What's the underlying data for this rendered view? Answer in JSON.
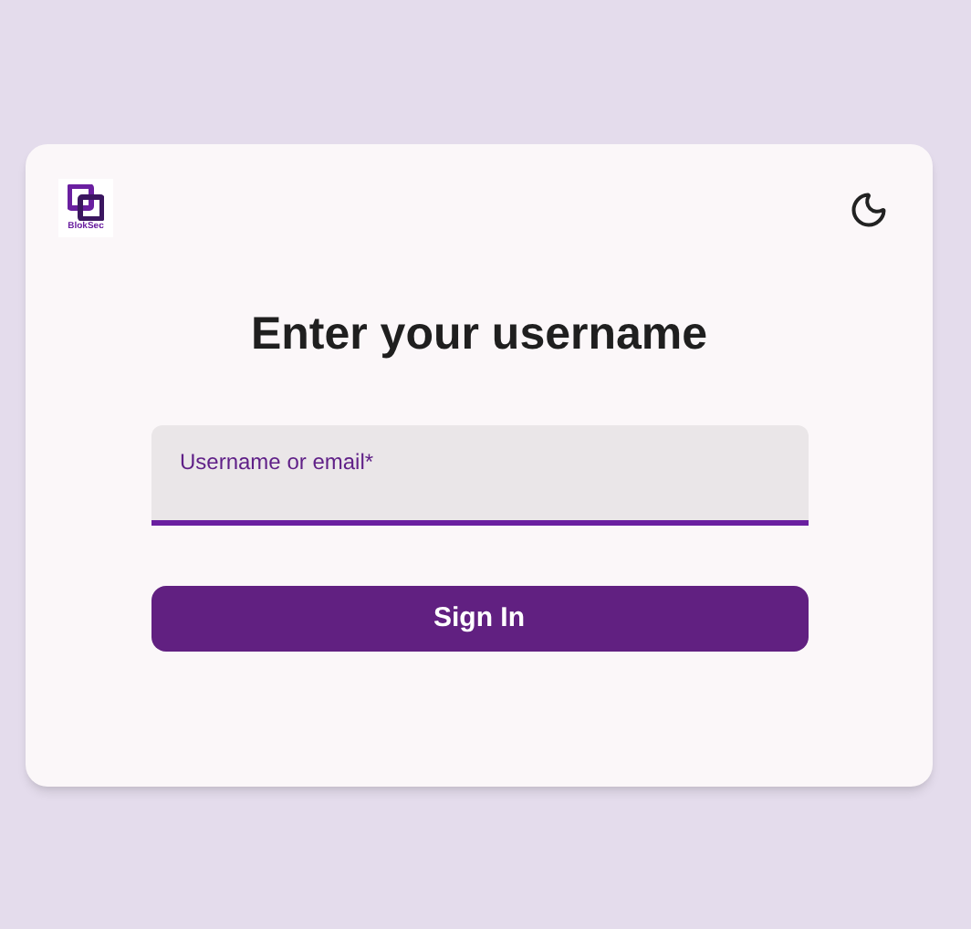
{
  "logo": {
    "text": "BlokSec"
  },
  "title": "Enter your username",
  "field": {
    "label": "Username or email*",
    "focused": true
  },
  "button": {
    "label": "Sign In"
  }
}
